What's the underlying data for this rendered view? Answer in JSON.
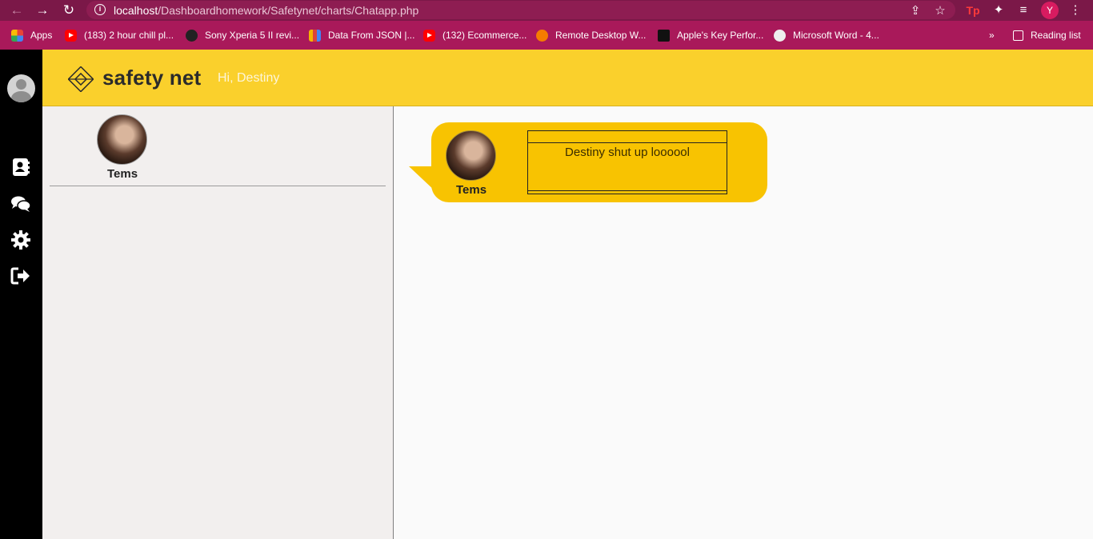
{
  "browser": {
    "url_host": "localhost",
    "url_path": "/Dashboardhomework/Safetynet/charts/Chatapp.php",
    "profile_initial": "Y",
    "bookmarks": [
      {
        "label": "Apps",
        "icon": "apps-grid-icon"
      },
      {
        "label": "(183) 2 hour chill pl...",
        "icon": "youtube-icon"
      },
      {
        "label": "Sony Xperia 5 II revi...",
        "icon": "site-icon"
      },
      {
        "label": "Data From JSON |...",
        "icon": "chart-icon"
      },
      {
        "label": "(132) Ecommerce...",
        "icon": "youtube-icon"
      },
      {
        "label": "Remote Desktop W...",
        "icon": "remote-desktop-icon"
      },
      {
        "label": "Apple's Key Perfor...",
        "icon": "medium-icon"
      },
      {
        "label": "Microsoft Word - 4...",
        "icon": "globe-icon"
      }
    ],
    "reading_list": "Reading list",
    "more": "»"
  },
  "header": {
    "brand": "safety net",
    "greeting": "Hi, Destiny"
  },
  "contacts": [
    {
      "name": "Tems"
    }
  ],
  "chat": {
    "messages": [
      {
        "sender": "Tems",
        "text": "Destiny shut up loooool"
      }
    ]
  },
  "colors": {
    "browser_bar": "#7b1848",
    "bookmarks_bar": "#a9195a",
    "header": "#fad02c",
    "bubble": "#f8c301",
    "sidebar": "#000000"
  }
}
